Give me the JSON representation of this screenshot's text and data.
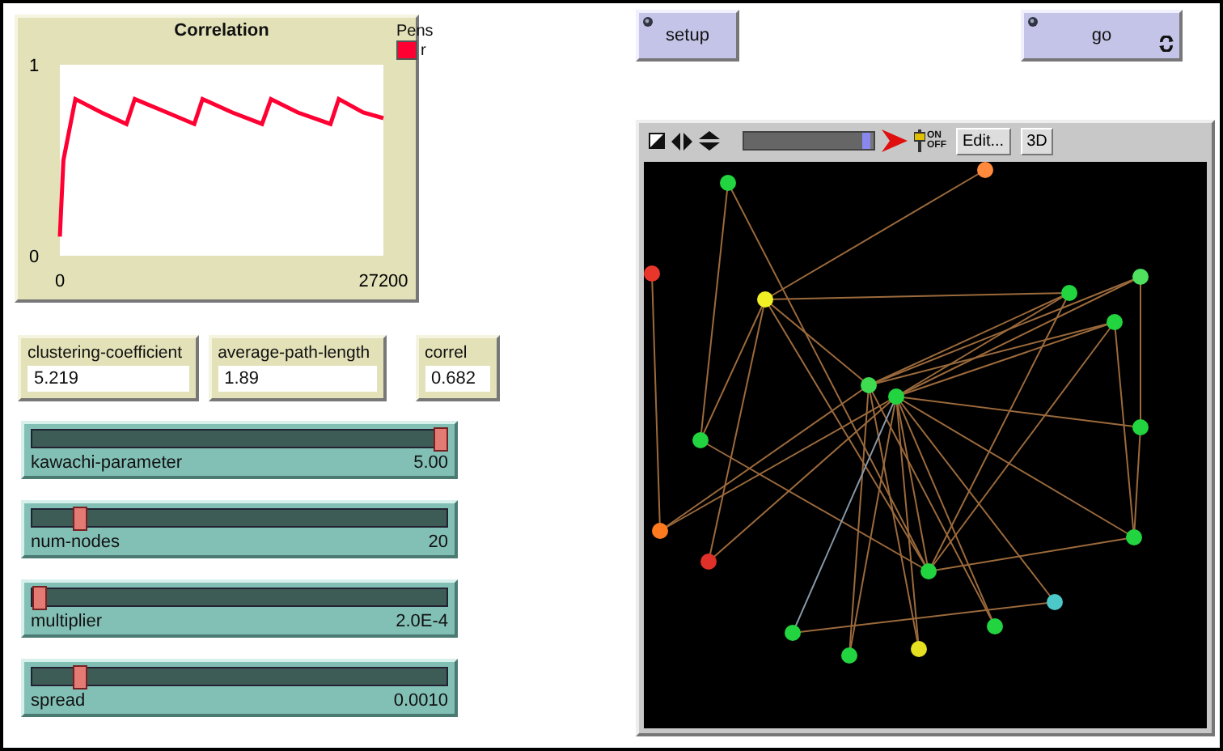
{
  "plot": {
    "legend_title": "Pens",
    "chart_data": {
      "type": "line",
      "title": "Correlation",
      "x": [
        0,
        300,
        1300,
        3500,
        5600,
        6300,
        9000,
        11300,
        12000,
        14500,
        17000,
        17750,
        20000,
        22750,
        23450,
        25500,
        27200
      ],
      "series": [
        {
          "name": "r",
          "color": "#ff0033",
          "values": [
            0.1,
            0.5,
            0.82,
            0.75,
            0.69,
            0.82,
            0.75,
            0.69,
            0.82,
            0.75,
            0.69,
            0.82,
            0.75,
            0.69,
            0.82,
            0.75,
            0.72
          ]
        }
      ],
      "xlim": [
        0,
        27200
      ],
      "ylim": [
        0,
        1
      ],
      "xticks": [
        0,
        27200
      ],
      "yticks": [
        0,
        1
      ]
    }
  },
  "monitors": [
    {
      "label": "clustering-coefficient",
      "value": "5.219"
    },
    {
      "label": "average-path-length",
      "value": "1.89"
    },
    {
      "label": "correl",
      "value": "0.682"
    }
  ],
  "sliders": [
    {
      "label": "kawachi-parameter",
      "value": "5.00",
      "level": 1.0
    },
    {
      "label": "num-nodes",
      "value": "20",
      "level": 0.1
    },
    {
      "label": "multiplier",
      "value": "2.0E-4",
      "level": 0.0
    },
    {
      "label": "spread",
      "value": "0.0010",
      "level": 0.1
    }
  ],
  "buttons": [
    {
      "label": "setup",
      "forever": false
    },
    {
      "label": "go",
      "forever": true
    }
  ],
  "view": {
    "speed_slider": {
      "level": 0.97
    },
    "updates_switch": {
      "on": true,
      "on_label": "ON",
      "off_label": "OFF"
    },
    "buttons": [
      "Edit...",
      "3D"
    ]
  }
}
